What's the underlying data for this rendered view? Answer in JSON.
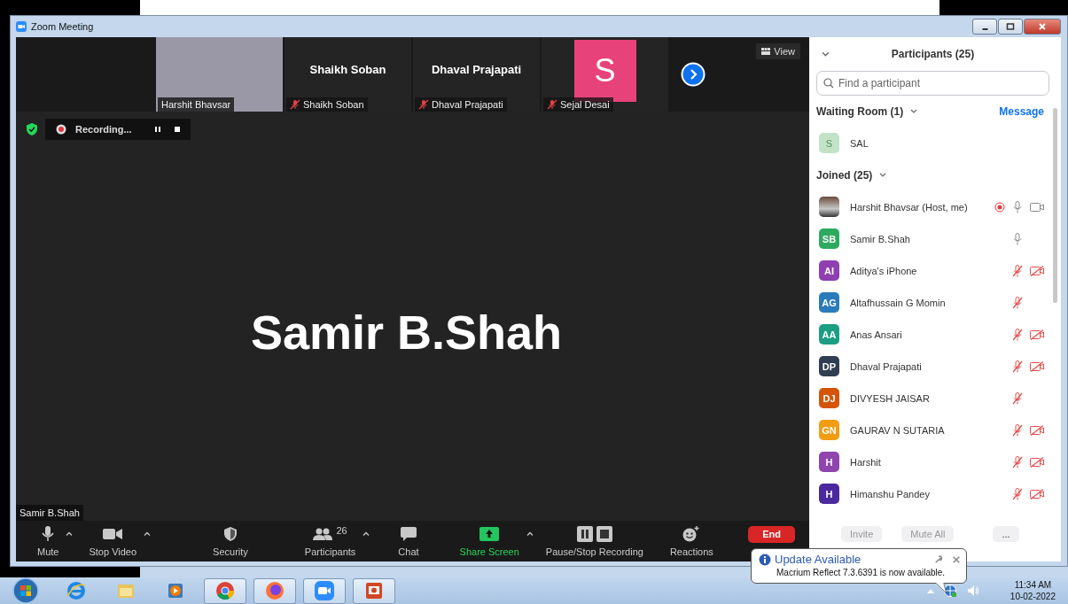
{
  "window": {
    "title": "Zoom Meeting"
  },
  "thumbnails": [
    {
      "kind": "video",
      "label": "Harshit Bhavsar",
      "muted": false
    },
    {
      "kind": "name",
      "name": "Shaikh Soban",
      "label": "Shaikh Soban",
      "muted": true
    },
    {
      "kind": "name",
      "name": "Dhaval Prajapati",
      "label": "Dhaval Prajapati",
      "muted": true
    },
    {
      "kind": "avatar",
      "name": "S",
      "label": "Sejal Desai",
      "muted": true,
      "color": "#e8427a"
    }
  ],
  "view_button": {
    "label": "View"
  },
  "recording": {
    "label": "Recording..."
  },
  "active_speaker": {
    "name": "Samir B.Shah",
    "tag": "Samir B.Shah"
  },
  "toolbar": [
    {
      "kind": "mic",
      "label": "Mute",
      "caret": true,
      "accent": false
    },
    {
      "kind": "video",
      "label": "Stop Video",
      "caret": true,
      "accent": false
    },
    {
      "kind": "shield",
      "label": "Security",
      "caret": false,
      "accent": false
    },
    {
      "kind": "people",
      "label": "Participants",
      "caret": true,
      "accent": false,
      "count": "26"
    },
    {
      "kind": "chat",
      "label": "Chat",
      "caret": false,
      "accent": false
    },
    {
      "kind": "share",
      "label": "Share Screen",
      "caret": true,
      "accent": true
    },
    {
      "kind": "record",
      "label": "Pause/Stop Recording",
      "caret": false,
      "accent": false
    },
    {
      "kind": "reactions",
      "label": "Reactions",
      "caret": false,
      "accent": false
    }
  ],
  "end_button": {
    "label": "End"
  },
  "participants_panel": {
    "title": "Participants (25)",
    "search": {
      "placeholder": "Find a participant"
    },
    "waiting_room": {
      "title": "Waiting Room (1)",
      "action": "Message",
      "items": [
        {
          "initials": "S",
          "name": "SAL",
          "color": "#c3e3c8"
        }
      ]
    },
    "joined": {
      "title": "Joined (25)",
      "items": [
        {
          "name": "Harshit Bhavsar (Host, me)",
          "photo": true,
          "recording": true,
          "muted": false,
          "camera": true,
          "video_off": false
        },
        {
          "initials": "SB",
          "name": "Samir B.Shah",
          "photo": false,
          "color": "#2daa5e",
          "recording": false,
          "muted": false,
          "camera": false
        },
        {
          "initials": "AI",
          "name": "Aditya's iPhone",
          "photo": false,
          "color": "#8e3fb0",
          "recording": false,
          "muted": true,
          "camera": true,
          "video_off": true
        },
        {
          "initials": "AG",
          "name": "Altafhussain G Momin",
          "photo": false,
          "color": "#2a7bb9",
          "recording": false,
          "muted": true,
          "camera": false
        },
        {
          "initials": "AA",
          "name": "Anas Ansari",
          "photo": false,
          "color": "#1b9e82",
          "recording": false,
          "muted": true,
          "camera": true,
          "video_off": true
        },
        {
          "initials": "DP",
          "name": "Dhaval Prajapati",
          "photo": false,
          "color": "#2f3e52",
          "recording": false,
          "muted": true,
          "camera": true,
          "video_off": true
        },
        {
          "initials": "DJ",
          "name": "DIVYESH JAISAR",
          "photo": false,
          "color": "#d55408",
          "recording": false,
          "muted": true,
          "camera": false
        },
        {
          "initials": "GN",
          "name": "GAURAV N SUTARIA",
          "photo": false,
          "color": "#f29c13",
          "recording": false,
          "muted": true,
          "camera": true,
          "video_off": true
        },
        {
          "initials": "H",
          "name": "Harshit",
          "photo": false,
          "color": "#8f45ad",
          "recording": false,
          "muted": true,
          "camera": true,
          "video_off": true
        },
        {
          "initials": "H",
          "name": "Himanshu Pandey",
          "photo": false,
          "color": "#4b2a9f",
          "recording": false,
          "muted": true,
          "camera": true,
          "video_off": true
        }
      ]
    },
    "buttons": [
      "Invite",
      "Mute All",
      "..."
    ]
  },
  "notification": {
    "title": "Update Available",
    "message": "Macrium Reflect 7.3.6391 is now available."
  },
  "taskbar": {
    "apps": [
      {
        "kind": "ie",
        "active": false
      },
      {
        "kind": "explorer",
        "active": false
      },
      {
        "kind": "media",
        "active": false
      },
      {
        "kind": "chrome",
        "active": true
      },
      {
        "kind": "firefox",
        "active": true
      },
      {
        "kind": "zoom",
        "active": true
      },
      {
        "kind": "slides",
        "active": true
      }
    ],
    "time": "11:34 AM",
    "date": "10-02-2022"
  }
}
